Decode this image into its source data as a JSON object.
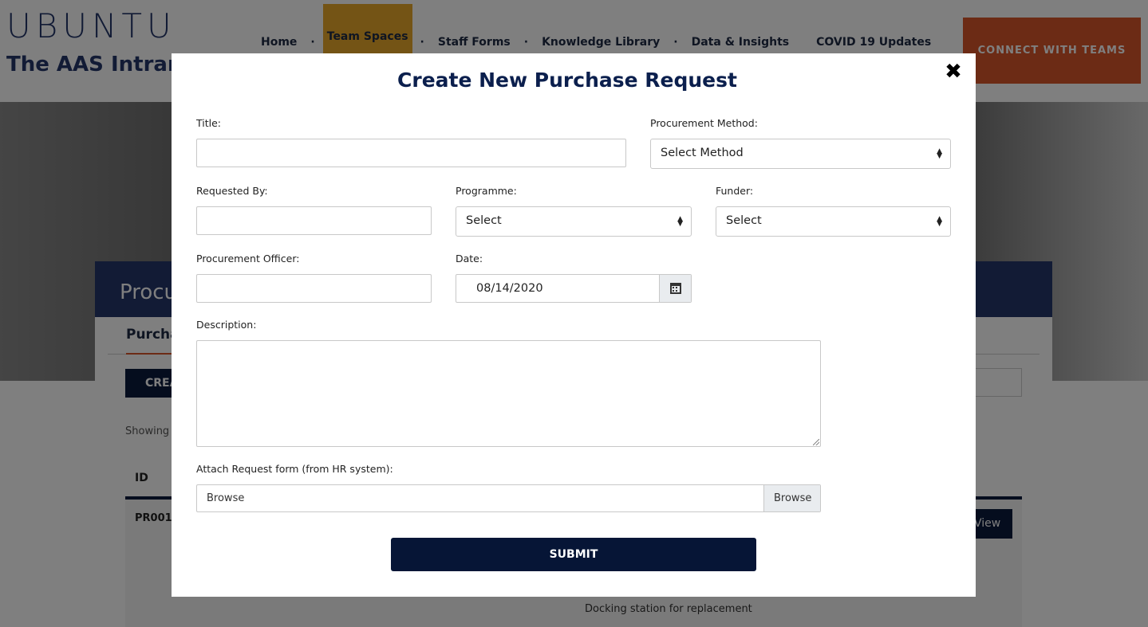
{
  "background": {
    "logo": "UBUNTU",
    "site_title": "The AAS Intranet",
    "nav": [
      "Home",
      "Team Spaces",
      "Staff Forms",
      "Knowledge Library",
      "Data & Insights",
      "COVID 19 Updates"
    ],
    "nav_active": "Team Spaces",
    "connect_button": "CONNECT WITH TEAMS",
    "page_title": "Procu",
    "tab": "Purcha",
    "create_button": "CREA",
    "showing": "Showing",
    "table_header_id": "ID",
    "row_id": "PR001",
    "view_button": "View",
    "row_description": "Docking station for replacement"
  },
  "modal": {
    "title": "Create New Purchase Request",
    "close_glyph": "✖",
    "fields": {
      "title_label": "Title:",
      "title_value": "",
      "procurement_method_label": "Procurement Method:",
      "procurement_method_value": "Select Method",
      "requested_by_label": "Requested By:",
      "programme_label": "Programme:",
      "programme_value": "Select",
      "funder_label": "Funder:",
      "funder_value": "Select",
      "procurement_officer_label": "Procurement Officer:",
      "date_label": "Date:",
      "date_value": "08/14/2020",
      "description_label": "Description:",
      "attach_label": "Attach Request form (from HR system):",
      "attach_placeholder": "Browse",
      "attach_button": "Browse"
    },
    "submit_button": "SUBMIT"
  },
  "icons": {
    "close": "close-icon",
    "calendar": "calendar-icon",
    "select_arrow": "sort-arrows-icon"
  },
  "colors": {
    "title": "#0b1f4d",
    "submit_bg": "#061536",
    "connect_bg": "#d9562b",
    "active_nav": "#e8a92a"
  }
}
